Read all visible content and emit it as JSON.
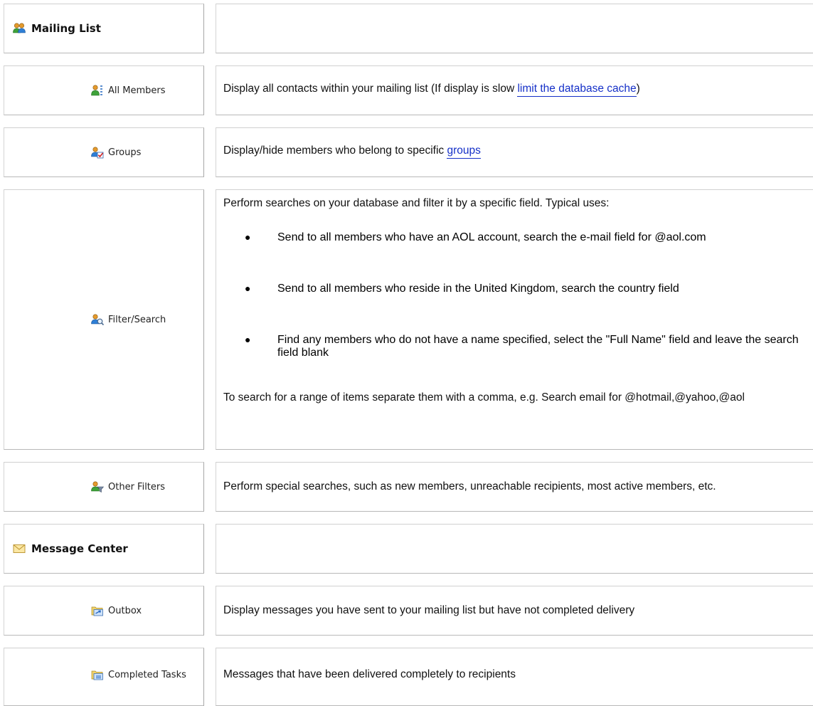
{
  "mailing_list": {
    "title": "Mailing List"
  },
  "all_members": {
    "label": "All Members",
    "desc_before": "Display all contacts within your mailing list (If display is slow ",
    "link": "limit the database cache",
    "desc_after": ")"
  },
  "groups": {
    "label": "Groups",
    "desc_before": "Display/hide members who belong to specific ",
    "link": "groups"
  },
  "filter_search": {
    "label": "Filter/Search",
    "intro": "Perform searches on your database and filter it by a specific field.  Typical uses:",
    "bullets": [
      "Send to all members who have an AOL account, search the e-mail field for @aol.com",
      "Send to all members who reside in the United Kingdom, search the country field",
      "Find any members who do not have a name specified, select the \"Full Name\" field and leave the search field blank"
    ],
    "outro": "To search for a range of items separate them with a comma, e.g. Search email for @hotmail,@yahoo,@aol"
  },
  "other_filters": {
    "label": "Other Filters",
    "desc": "Perform special searches, such as new members, unreachable recipients, most active members, etc."
  },
  "message_center": {
    "title": "Message Center"
  },
  "outbox": {
    "label": "Outbox",
    "desc": "Display messages you have sent to your mailing list but have not completed delivery"
  },
  "completed_tasks": {
    "label": "Completed Tasks",
    "desc": "Messages that have been delivered completely to recipients"
  }
}
